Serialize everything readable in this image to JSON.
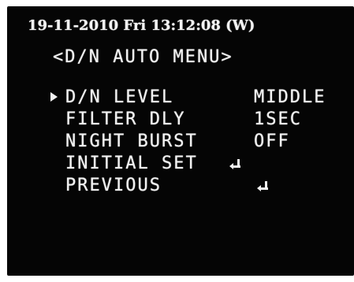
{
  "osd": {
    "timestamp": "19-11-2010 Fri 13:12:08 (W)",
    "menu_title": "<D/N AUTO MENU>",
    "items": [
      {
        "label": "D/N LEVEL",
        "value": "MIDDLE",
        "selected": true
      },
      {
        "label": "FILTER DLY",
        "value": "1SEC"
      },
      {
        "label": "NIGHT BURST",
        "value": "OFF"
      },
      {
        "label": "INITIAL SET",
        "action_icon": "enter-icon"
      },
      {
        "label": "PREVIOUS",
        "action_icon": "enter-icon"
      }
    ]
  },
  "colors": {
    "screen_background": "#050505",
    "osd_text": "#f2f2f2"
  }
}
